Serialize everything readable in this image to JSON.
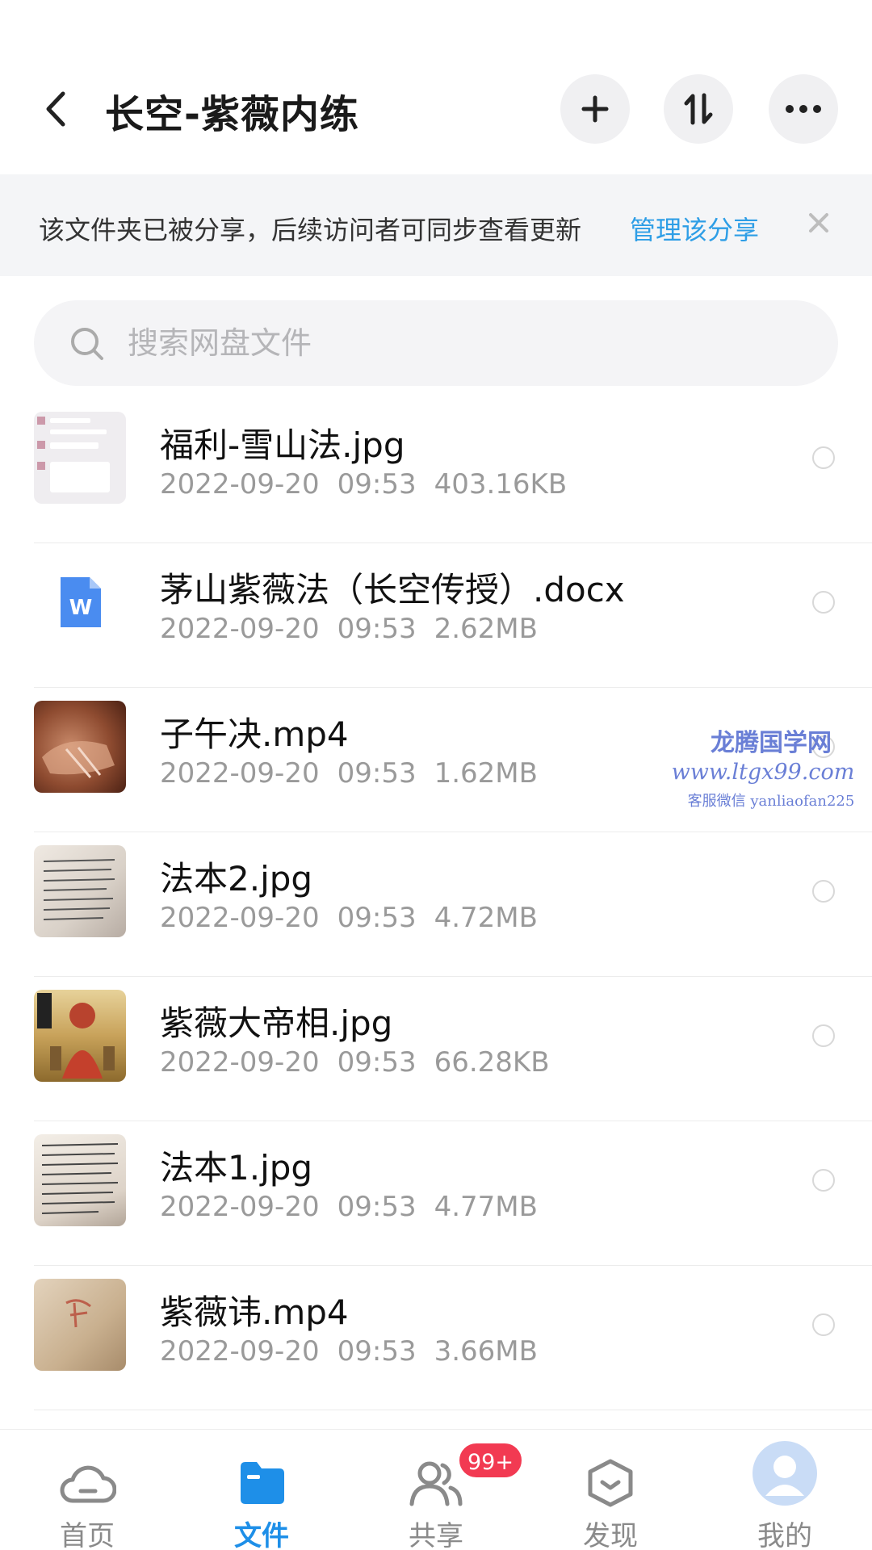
{
  "header": {
    "title": "长空-紫薇内练"
  },
  "banner": {
    "text": "该文件夹已被分享，后续访问者可同步查看更新",
    "link": "管理该分享"
  },
  "search": {
    "placeholder": "搜索网盘文件"
  },
  "files": [
    {
      "name": "福利-雪山法.jpg",
      "date": "2022-09-20",
      "time": "09:53",
      "size": "403.16KB",
      "thumb": "image"
    },
    {
      "name": "茅山紫薇法（长空传授）.docx",
      "date": "2022-09-20",
      "time": "09:53",
      "size": "2.62MB",
      "thumb": "word-doc-icon"
    },
    {
      "name": "子午决.mp4",
      "date": "2022-09-20",
      "time": "09:53",
      "size": "1.62MB",
      "thumb": "video"
    },
    {
      "name": "法本2.jpg",
      "date": "2022-09-20",
      "time": "09:53",
      "size": "4.72MB",
      "thumb": "image"
    },
    {
      "name": "紫薇大帝相.jpg",
      "date": "2022-09-20",
      "time": "09:53",
      "size": "66.28KB",
      "thumb": "image"
    },
    {
      "name": "法本1.jpg",
      "date": "2022-09-20",
      "time": "09:53",
      "size": "4.77MB",
      "thumb": "image"
    },
    {
      "name": "紫薇讳.mp4",
      "date": "2022-09-20",
      "time": "09:53",
      "size": "3.66MB",
      "thumb": "video"
    }
  ],
  "watermark": {
    "title": "龙腾国学网",
    "url": "www.ltgx99.com",
    "contact": "客服微信 yanliaofan225"
  },
  "nav": {
    "home": "首页",
    "files": "文件",
    "share": "共享",
    "share_badge": "99+",
    "discover": "发现",
    "mine": "我的"
  },
  "colors": {
    "accent": "#1e8fe8",
    "link": "#2e9ee6",
    "badge": "#f23a52"
  }
}
